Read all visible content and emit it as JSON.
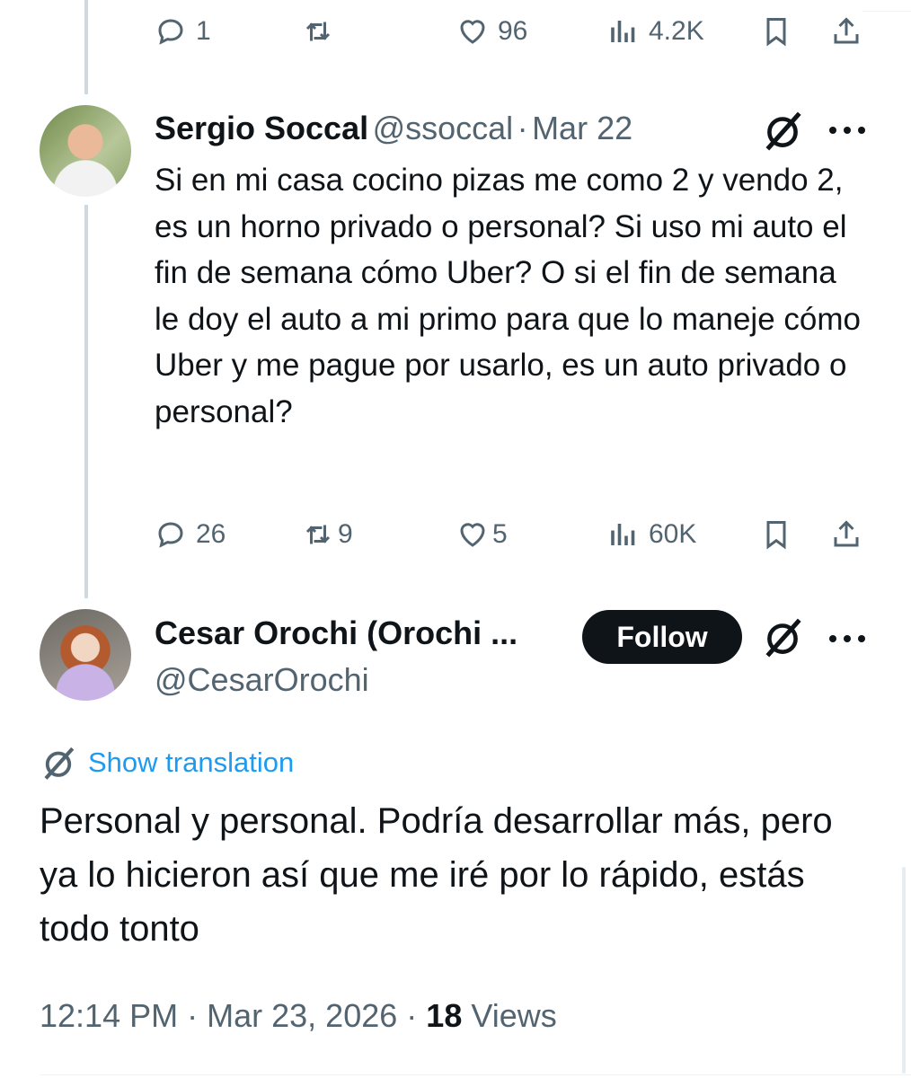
{
  "top_actions": {
    "reply_count": "1",
    "repost_count": "",
    "like_count": "96",
    "views_count": "4.2K"
  },
  "reply1": {
    "name": "Sergio Soccal",
    "handle": "@ssoccal",
    "separator": "·",
    "date": "Mar 22",
    "text": "Si en mi casa cocino pizas me como 2 y vendo 2, es un horno privado o personal? Si uso mi auto el fin de semana cómo Uber? O si el fin de semana le doy el auto a mi primo para que lo maneje cómo Uber y me pague por usarlo, es un auto privado o personal?",
    "reply_count": "26",
    "repost_count": "9",
    "like_count": "5",
    "views_count": "60K"
  },
  "main_post": {
    "name": "Cesar Orochi (Orochi ...",
    "handle": "@CesarOrochi",
    "follow_label": "Follow",
    "translation_label": "Show translation",
    "text": "Personal y personal. Podría desarrollar más, pero ya lo hicieron así que me iré por lo rápido, estás todo tonto",
    "time": "12:14 PM",
    "dot": "·",
    "date": "Mar 23, 2026",
    "views_count": "18",
    "views_label": "Views"
  },
  "colors": {
    "text": "#0f1419",
    "muted": "#536471",
    "link": "#1d9bf0",
    "thread_line": "#cfd9de"
  }
}
